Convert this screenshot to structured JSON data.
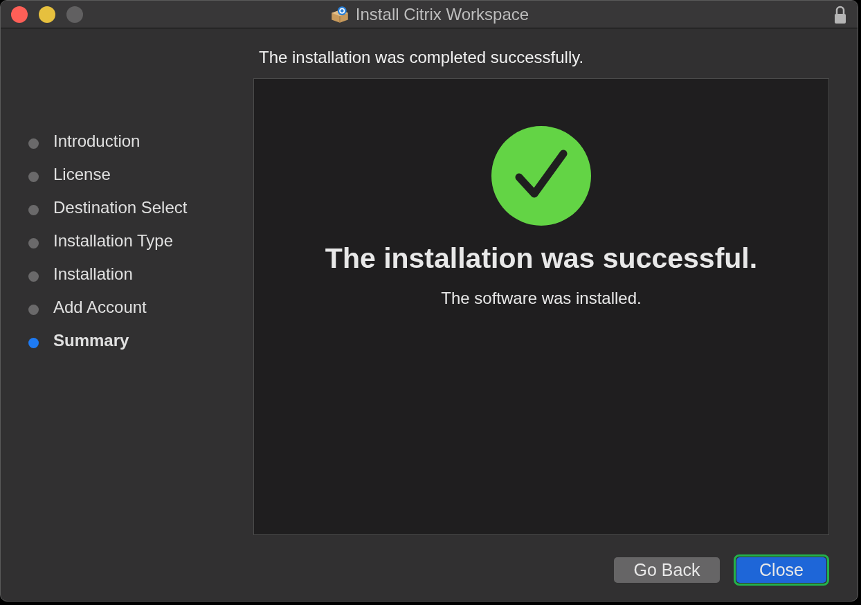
{
  "window": {
    "title": "Install Citrix Workspace"
  },
  "header": "The installation was completed successfully.",
  "steps": [
    {
      "label": "Introduction",
      "selected": false
    },
    {
      "label": "License",
      "selected": false
    },
    {
      "label": "Destination Select",
      "selected": false
    },
    {
      "label": "Installation Type",
      "selected": false
    },
    {
      "label": "Installation",
      "selected": false
    },
    {
      "label": "Add Account",
      "selected": false
    },
    {
      "label": "Summary",
      "selected": true
    }
  ],
  "result": {
    "title": "The installation was successful.",
    "message": "The software was installed."
  },
  "buttons": [
    {
      "label": "Go Back",
      "kind": "secondary"
    },
    {
      "label": "Close",
      "kind": "default"
    }
  ]
}
